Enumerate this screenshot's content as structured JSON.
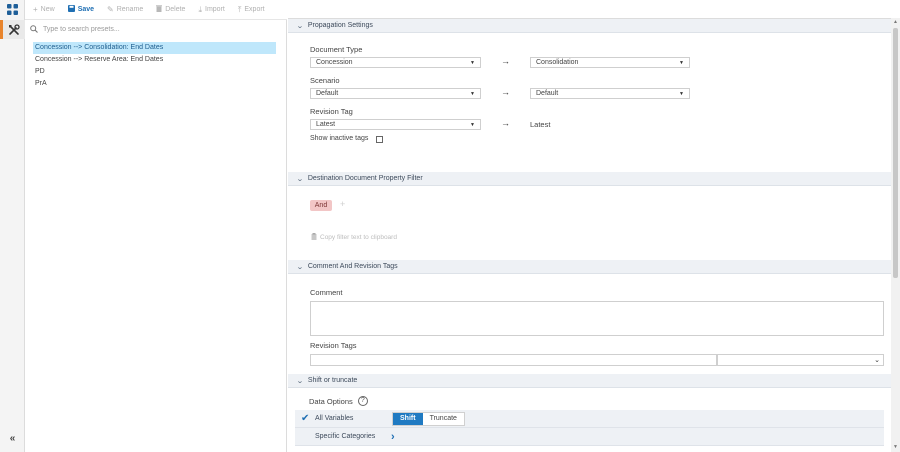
{
  "toolbar": {
    "new_label": "New",
    "save_label": "Save",
    "rename_label": "Rename",
    "delete_label": "Delete",
    "import_label": "Import",
    "export_label": "Export"
  },
  "search": {
    "placeholder": "Type to search presets..."
  },
  "presets": [
    "Concession --> Consolidation: End Dates",
    "Concession --> Reserve Area: End Dates",
    "PD",
    "PrA"
  ],
  "propagation": {
    "title": "Propagation Settings",
    "document_type_label": "Document Type",
    "document_type_from": "Concession",
    "document_type_to": "Consolidation",
    "scenario_label": "Scenario",
    "scenario_from": "Default",
    "scenario_to": "Default",
    "revision_tag_label": "Revision Tag",
    "revision_tag_from": "Latest",
    "revision_tag_to": "Latest",
    "show_inactive_label": "Show inactive tags"
  },
  "filter": {
    "title": "Destination Document Property Filter",
    "and_label": "And",
    "copy_label": "Copy filter text to clipboard"
  },
  "comment": {
    "title": "Comment And Revision Tags",
    "comment_label": "Comment",
    "revision_tags_label": "Revision Tags"
  },
  "shift": {
    "title": "Shift or truncate",
    "data_options_label": "Data Options",
    "all_variables_label": "All Variables",
    "shift_label": "Shift",
    "truncate_label": "Truncate",
    "specific_categories_label": "Specific Categories"
  },
  "colors": {
    "accent": "#1f7ac2",
    "selected_row": "#bfe7fb",
    "and_chip": "#f2c6c6",
    "rail_active": "#e8842c"
  },
  "icons": {
    "apps": "grid-icon",
    "tools": "tools-icon",
    "collapse": "double-chevron-left-icon"
  }
}
